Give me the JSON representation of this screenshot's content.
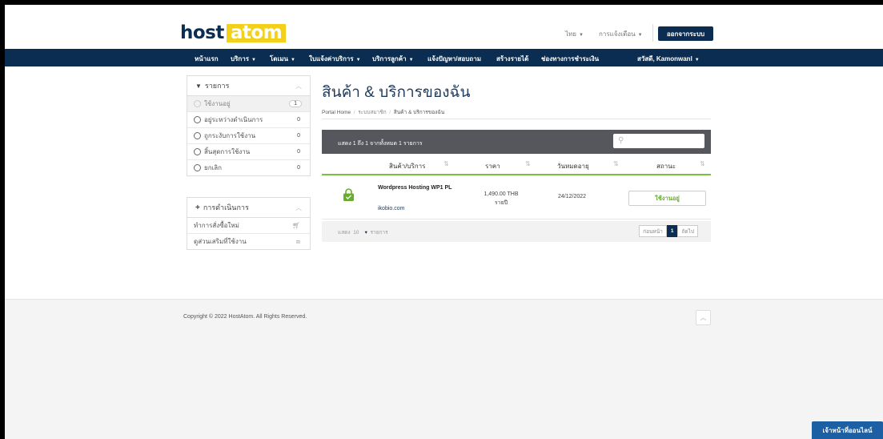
{
  "brand": {
    "logo_part1": "host",
    "logo_part2": "atom"
  },
  "topbar": {
    "language": "ไทย",
    "notifications": "การแจ้งเตือน",
    "logout": "ออกจากระบบ"
  },
  "nav": {
    "items": [
      "หน้าแรก",
      "บริการ",
      "โดเมน",
      "ใบแจ้งค่าบริการ",
      "บริการลูกค้า",
      "แจ้งปัญหา/สอบถาม",
      "สร้างรายได้",
      "ช่องทางการชำระเงิน"
    ],
    "user": "สวัสดี, Kamonwanl"
  },
  "sidebar": {
    "filter_title": "รายการ",
    "filters": [
      {
        "label": "ใช้งานอยู่",
        "count": "1"
      },
      {
        "label": "อยู่ระหว่างดำเนินการ",
        "count": "0"
      },
      {
        "label": "ถูกระงับการใช้งาน",
        "count": "0"
      },
      {
        "label": "สิ้นสุดการใช้งาน",
        "count": "0"
      },
      {
        "label": "ยกเลิก",
        "count": "0"
      }
    ],
    "actions_title": "การดำเนินการ",
    "actions": [
      {
        "label": "ทำการสั่งซื้อใหม่"
      },
      {
        "label": "ดูส่วนเสริมที่ใช้งาน"
      }
    ]
  },
  "main": {
    "title": "สินค้า & บริการของฉัน",
    "breadcrumb": {
      "home": "Portal Home",
      "sep": "/",
      "member": "ระบบสมาชิก",
      "current": "สินค้า & บริการของฉัน"
    },
    "table_info": "แสดง 1 ถึง 1 จากทั้งหมด 1 รายการ",
    "columns": [
      "สินค้า/บริการ",
      "ราคา",
      "วันหมดอายุ",
      "สถานะ"
    ],
    "rows": [
      {
        "product": "Wordpress Hosting WP1 PL",
        "domain": "ikobio.com",
        "price": "1,490.00 THB",
        "cycle": "รายปี",
        "due": "24/12/2022",
        "status": "ใช้งานอยู่"
      }
    ],
    "length": {
      "prefix": "แสดง",
      "value": "10",
      "suffix": "รายการ"
    },
    "pager": {
      "prev": "ก่อนหน้า",
      "current": "1",
      "next": "ถัดไป"
    }
  },
  "footer": {
    "copyright": "Copyright © 2022 HostAtom. All Rights Reserved."
  },
  "chat": {
    "label": "เจ้าหน้าที่ออนไลน์"
  },
  "colors": {
    "navy": "#0b2d52",
    "accent_yellow": "#f3d11b",
    "green": "#6aad2e",
    "chat_blue": "#1c5fa3"
  }
}
